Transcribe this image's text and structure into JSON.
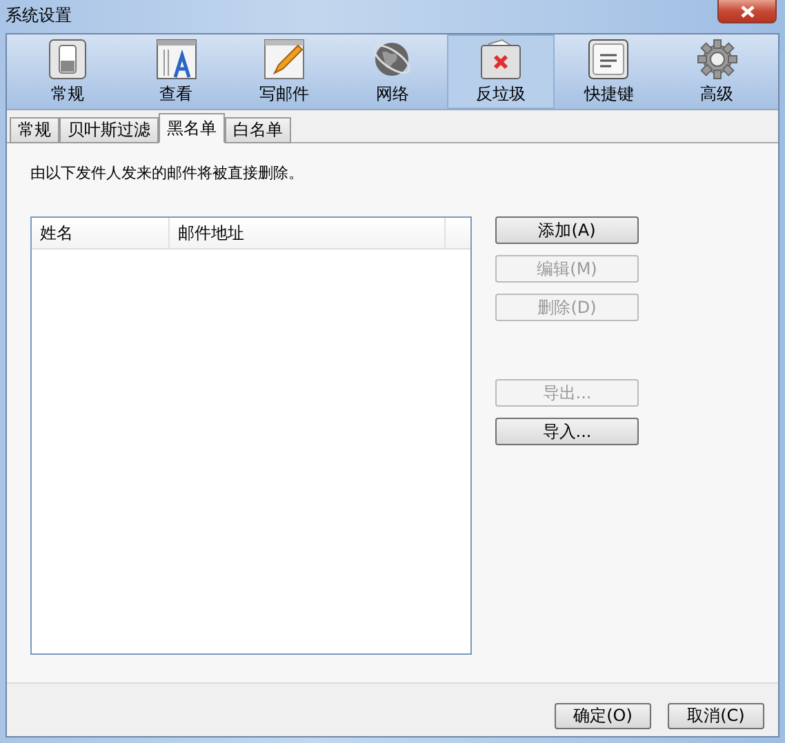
{
  "window": {
    "title": "系统设置"
  },
  "toolbar": [
    {
      "label": "常规",
      "kind": "switch",
      "selected": false
    },
    {
      "label": "查看",
      "kind": "reader",
      "selected": false
    },
    {
      "label": "写邮件",
      "kind": "compose",
      "selected": false
    },
    {
      "label": "网络",
      "kind": "globe",
      "selected": false
    },
    {
      "label": "反垃圾",
      "kind": "junk",
      "selected": true
    },
    {
      "label": "快捷键",
      "kind": "key",
      "selected": false
    },
    {
      "label": "高级",
      "kind": "gear",
      "selected": false
    }
  ],
  "tabs": [
    {
      "label": "常规",
      "selected": false
    },
    {
      "label": "贝叶斯过滤",
      "selected": false
    },
    {
      "label": "黑名单",
      "selected": true
    },
    {
      "label": "白名单",
      "selected": false
    }
  ],
  "description": "由以下发件人发来的邮件将被直接删除。",
  "table": {
    "columns": [
      "姓名",
      "邮件地址"
    ]
  },
  "actions": [
    {
      "label": "添加(A)",
      "disabled": false
    },
    {
      "label": "编辑(M)",
      "disabled": true
    },
    {
      "label": "删除(D)",
      "disabled": true
    },
    {
      "label": "导出...",
      "disabled": true
    },
    {
      "label": "导入...",
      "disabled": false
    }
  ],
  "footer_buttons": [
    "确定(O)",
    "取消(C)"
  ]
}
